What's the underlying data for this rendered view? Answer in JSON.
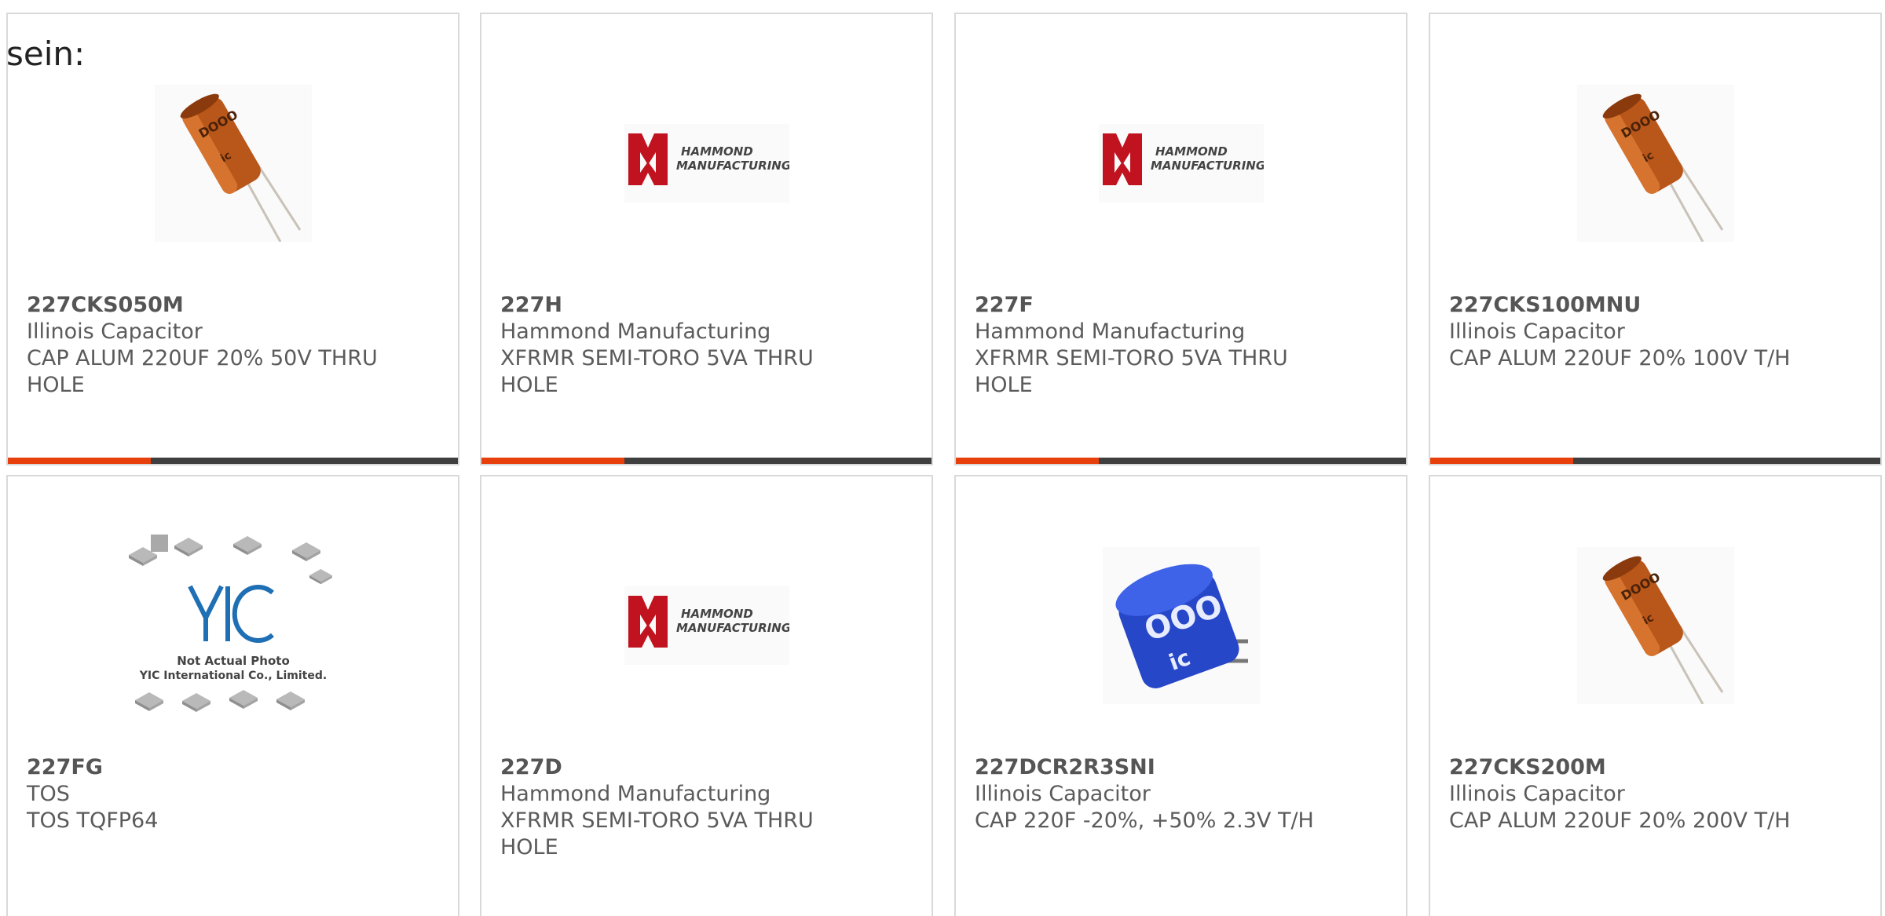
{
  "heading": "sein:",
  "colors": {
    "accent": "#e8400c",
    "bar": "#3f3f3f",
    "card_border": "#d9d9d9",
    "text": "#5b5b5b"
  },
  "hammond_logo": {
    "line1": "HAMMOND",
    "line2": "MANUFACTURING."
  },
  "yic_logo": {
    "mark": "YIC",
    "line1": "Not Actual Photo",
    "line2": "YIC International Co., Limited."
  },
  "products": [
    {
      "part_number": "227CKS050M",
      "manufacturer": "Illinois Capacitor",
      "description": "CAP ALUM 220UF 20% 50V THRU HOLE",
      "image": "electrolytic-capacitor-icon"
    },
    {
      "part_number": "227H",
      "manufacturer": "Hammond Manufacturing",
      "description": "XFRMR SEMI-TORO 5VA THRU HOLE",
      "image": "hammond-logo"
    },
    {
      "part_number": "227F",
      "manufacturer": "Hammond Manufacturing",
      "description": "XFRMR SEMI-TORO 5VA THRU HOLE",
      "image": "hammond-logo"
    },
    {
      "part_number": "227CKS100MNU",
      "manufacturer": "Illinois Capacitor",
      "description": "CAP ALUM 220UF 20% 100V T/H",
      "image": "electrolytic-capacitor-icon"
    },
    {
      "part_number": "227FG",
      "manufacturer": "TOS",
      "description": "TOS TQFP64",
      "image": "yic-placeholder"
    },
    {
      "part_number": "227D",
      "manufacturer": "Hammond Manufacturing",
      "description": "XFRMR SEMI-TORO 5VA THRU HOLE",
      "image": "hammond-logo"
    },
    {
      "part_number": "227DCR2R3SNI",
      "manufacturer": "Illinois Capacitor",
      "description": "CAP 220F -20%, +50% 2.3V T/H",
      "image": "supercapacitor-icon"
    },
    {
      "part_number": "227CKS200M",
      "manufacturer": "Illinois Capacitor",
      "description": "CAP ALUM 220UF 20% 200V T/H",
      "image": "electrolytic-capacitor-icon"
    }
  ]
}
